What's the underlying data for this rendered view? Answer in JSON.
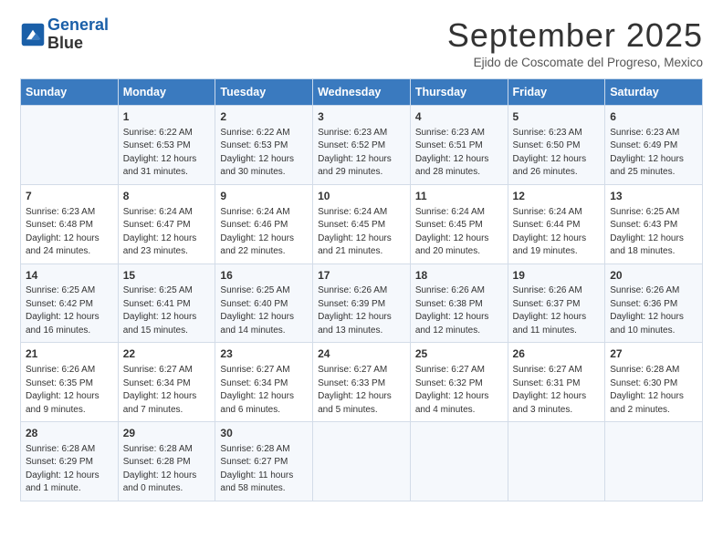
{
  "logo": {
    "line1": "General",
    "line2": "Blue"
  },
  "header": {
    "month_title": "September 2025",
    "subtitle": "Ejido de Coscomate del Progreso, Mexico"
  },
  "days_of_week": [
    "Sunday",
    "Monday",
    "Tuesday",
    "Wednesday",
    "Thursday",
    "Friday",
    "Saturday"
  ],
  "weeks": [
    [
      {
        "day": "",
        "detail": ""
      },
      {
        "day": "1",
        "detail": "Sunrise: 6:22 AM\nSunset: 6:53 PM\nDaylight: 12 hours\nand 31 minutes."
      },
      {
        "day": "2",
        "detail": "Sunrise: 6:22 AM\nSunset: 6:53 PM\nDaylight: 12 hours\nand 30 minutes."
      },
      {
        "day": "3",
        "detail": "Sunrise: 6:23 AM\nSunset: 6:52 PM\nDaylight: 12 hours\nand 29 minutes."
      },
      {
        "day": "4",
        "detail": "Sunrise: 6:23 AM\nSunset: 6:51 PM\nDaylight: 12 hours\nand 28 minutes."
      },
      {
        "day": "5",
        "detail": "Sunrise: 6:23 AM\nSunset: 6:50 PM\nDaylight: 12 hours\nand 26 minutes."
      },
      {
        "day": "6",
        "detail": "Sunrise: 6:23 AM\nSunset: 6:49 PM\nDaylight: 12 hours\nand 25 minutes."
      }
    ],
    [
      {
        "day": "7",
        "detail": "Sunrise: 6:23 AM\nSunset: 6:48 PM\nDaylight: 12 hours\nand 24 minutes."
      },
      {
        "day": "8",
        "detail": "Sunrise: 6:24 AM\nSunset: 6:47 PM\nDaylight: 12 hours\nand 23 minutes."
      },
      {
        "day": "9",
        "detail": "Sunrise: 6:24 AM\nSunset: 6:46 PM\nDaylight: 12 hours\nand 22 minutes."
      },
      {
        "day": "10",
        "detail": "Sunrise: 6:24 AM\nSunset: 6:45 PM\nDaylight: 12 hours\nand 21 minutes."
      },
      {
        "day": "11",
        "detail": "Sunrise: 6:24 AM\nSunset: 6:45 PM\nDaylight: 12 hours\nand 20 minutes."
      },
      {
        "day": "12",
        "detail": "Sunrise: 6:24 AM\nSunset: 6:44 PM\nDaylight: 12 hours\nand 19 minutes."
      },
      {
        "day": "13",
        "detail": "Sunrise: 6:25 AM\nSunset: 6:43 PM\nDaylight: 12 hours\nand 18 minutes."
      }
    ],
    [
      {
        "day": "14",
        "detail": "Sunrise: 6:25 AM\nSunset: 6:42 PM\nDaylight: 12 hours\nand 16 minutes."
      },
      {
        "day": "15",
        "detail": "Sunrise: 6:25 AM\nSunset: 6:41 PM\nDaylight: 12 hours\nand 15 minutes."
      },
      {
        "day": "16",
        "detail": "Sunrise: 6:25 AM\nSunset: 6:40 PM\nDaylight: 12 hours\nand 14 minutes."
      },
      {
        "day": "17",
        "detail": "Sunrise: 6:26 AM\nSunset: 6:39 PM\nDaylight: 12 hours\nand 13 minutes."
      },
      {
        "day": "18",
        "detail": "Sunrise: 6:26 AM\nSunset: 6:38 PM\nDaylight: 12 hours\nand 12 minutes."
      },
      {
        "day": "19",
        "detail": "Sunrise: 6:26 AM\nSunset: 6:37 PM\nDaylight: 12 hours\nand 11 minutes."
      },
      {
        "day": "20",
        "detail": "Sunrise: 6:26 AM\nSunset: 6:36 PM\nDaylight: 12 hours\nand 10 minutes."
      }
    ],
    [
      {
        "day": "21",
        "detail": "Sunrise: 6:26 AM\nSunset: 6:35 PM\nDaylight: 12 hours\nand 9 minutes."
      },
      {
        "day": "22",
        "detail": "Sunrise: 6:27 AM\nSunset: 6:34 PM\nDaylight: 12 hours\nand 7 minutes."
      },
      {
        "day": "23",
        "detail": "Sunrise: 6:27 AM\nSunset: 6:34 PM\nDaylight: 12 hours\nand 6 minutes."
      },
      {
        "day": "24",
        "detail": "Sunrise: 6:27 AM\nSunset: 6:33 PM\nDaylight: 12 hours\nand 5 minutes."
      },
      {
        "day": "25",
        "detail": "Sunrise: 6:27 AM\nSunset: 6:32 PM\nDaylight: 12 hours\nand 4 minutes."
      },
      {
        "day": "26",
        "detail": "Sunrise: 6:27 AM\nSunset: 6:31 PM\nDaylight: 12 hours\nand 3 minutes."
      },
      {
        "day": "27",
        "detail": "Sunrise: 6:28 AM\nSunset: 6:30 PM\nDaylight: 12 hours\nand 2 minutes."
      }
    ],
    [
      {
        "day": "28",
        "detail": "Sunrise: 6:28 AM\nSunset: 6:29 PM\nDaylight: 12 hours\nand 1 minute."
      },
      {
        "day": "29",
        "detail": "Sunrise: 6:28 AM\nSunset: 6:28 PM\nDaylight: 12 hours\nand 0 minutes."
      },
      {
        "day": "30",
        "detail": "Sunrise: 6:28 AM\nSunset: 6:27 PM\nDaylight: 11 hours\nand 58 minutes."
      },
      {
        "day": "",
        "detail": ""
      },
      {
        "day": "",
        "detail": ""
      },
      {
        "day": "",
        "detail": ""
      },
      {
        "day": "",
        "detail": ""
      }
    ]
  ]
}
